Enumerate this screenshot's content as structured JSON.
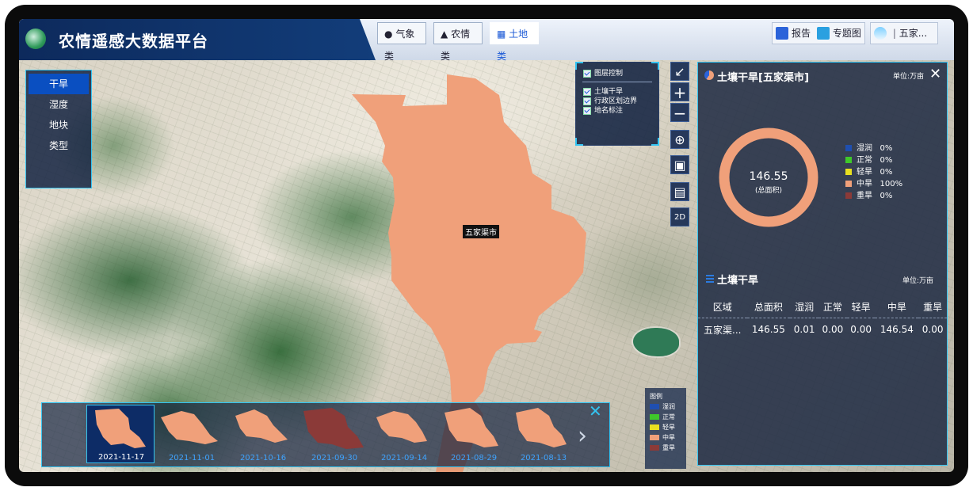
{
  "app": {
    "title": "农情遥感大数据平台"
  },
  "nav": {
    "tabs": [
      {
        "label": "气象类"
      },
      {
        "label": "农情类"
      },
      {
        "label": "土地类"
      }
    ],
    "report_label": "报告",
    "thematic_label": "专题图",
    "region_label": "五家..."
  },
  "layer_menu": {
    "items": [
      "干旱",
      "湿度",
      "地块",
      "类型"
    ]
  },
  "layer_control": {
    "title": "图层控制",
    "items": [
      "土壤干旱",
      "行政区划边界",
      "地名标注"
    ]
  },
  "toolbar": {
    "mode_label": "2D"
  },
  "map": {
    "region_label": "五家渠市"
  },
  "panel": {
    "title": "土壤干旱[五家渠市]",
    "unit": "单位:万亩",
    "total_value": "146.55",
    "total_caption": "(总面积)",
    "legend": [
      {
        "name": "湿润",
        "pct": "0%",
        "color": "#1f4fb0"
      },
      {
        "name": "正常",
        "pct": "0%",
        "color": "#3fc92a"
      },
      {
        "name": "轻旱",
        "pct": "0%",
        "color": "#e8e020"
      },
      {
        "name": "中旱",
        "pct": "100%",
        "color": "#f0a07a"
      },
      {
        "name": "重旱",
        "pct": "0%",
        "color": "#8b3a38"
      }
    ],
    "table_title": "土壤干旱",
    "table_unit": "单位:万亩",
    "columns": [
      "区域",
      "总面积",
      "湿润",
      "正常",
      "轻旱",
      "中旱",
      "重旱"
    ],
    "rows": [
      [
        "五家渠...",
        "146.55",
        "0.01",
        "0.00",
        "0.00",
        "146.54",
        "0.00"
      ]
    ]
  },
  "timeline": {
    "dates": [
      "2021-11-17",
      "2021-11-01",
      "2021-10-16",
      "2021-09-30",
      "2021-09-14",
      "2021-08-29",
      "2021-08-13"
    ]
  },
  "map_legend": {
    "title": "图例",
    "items": [
      {
        "name": "湿润",
        "color": "#1f4fb0"
      },
      {
        "name": "正常",
        "color": "#3fc92a"
      },
      {
        "name": "轻旱",
        "color": "#e8e020"
      },
      {
        "name": "中旱",
        "color": "#f0a07a"
      },
      {
        "name": "重旱",
        "color": "#8b3a38"
      }
    ]
  },
  "colors": {
    "accent": "#33c4f2",
    "region": "#f0a07a",
    "header_dark": "#0d2a5c"
  }
}
